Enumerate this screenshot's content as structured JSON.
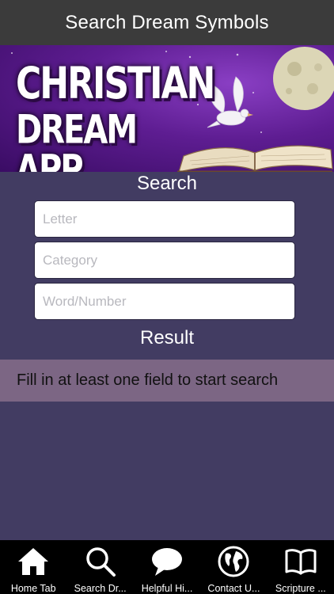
{
  "navbar": {
    "title": "Search Dream Symbols"
  },
  "banner": {
    "line1": "CHRISTIAN",
    "line2": "DREAM APP"
  },
  "search": {
    "heading": "Search",
    "letter_placeholder": "Letter",
    "category_placeholder": "Category",
    "word_placeholder": "Word/Number"
  },
  "result": {
    "heading": "Result",
    "message": "Fill in at least one field to start search"
  },
  "tabs": [
    {
      "label": "Home Tab",
      "icon": "home-icon"
    },
    {
      "label": "Search Dr...",
      "icon": "search-icon"
    },
    {
      "label": "Helpful Hi...",
      "icon": "speech-bubble-icon"
    },
    {
      "label": "Contact U...",
      "icon": "globe-icon"
    },
    {
      "label": "Scripture ...",
      "icon": "book-icon"
    }
  ],
  "colors": {
    "background": "#423c62",
    "navbar": "#3b3b3b",
    "result_bar": "#7c6684",
    "tabbar": "#000000"
  }
}
